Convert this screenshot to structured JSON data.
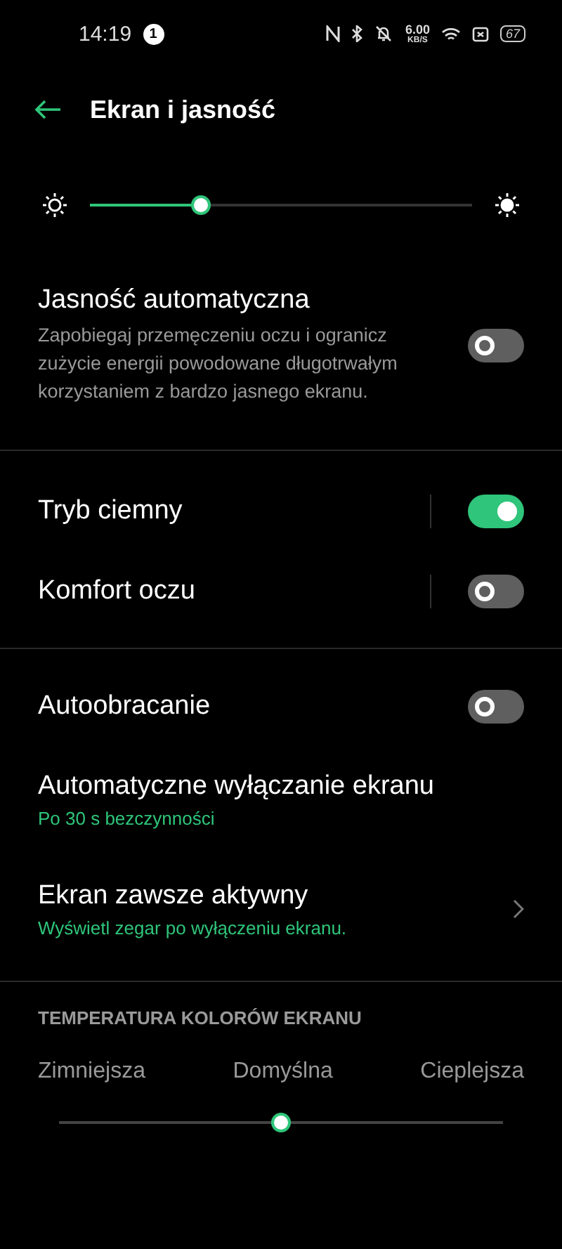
{
  "status_bar": {
    "time": "14:19",
    "notification_count": "1",
    "net_speed": "6.00",
    "net_unit": "KB/S",
    "battery": "67"
  },
  "header": {
    "title": "Ekran i jasność"
  },
  "brightness": {
    "level": 0.29
  },
  "sections": [
    {
      "items": [
        {
          "kind": "toggle",
          "title": "Jasność automatyczna",
          "description": "Zapobiegaj przemęczeniu oczu i ogranicz zużycie energii powodowane długotrwałym korzystaniem z bardzo jasnego ekranu.",
          "on": false
        }
      ]
    },
    {
      "items": [
        {
          "kind": "toggle_split",
          "title": "Tryb ciemny",
          "on": true
        },
        {
          "kind": "toggle_split",
          "title": "Komfort oczu",
          "on": false
        }
      ]
    },
    {
      "items": [
        {
          "kind": "toggle",
          "title": "Autoobracanie",
          "on": false
        },
        {
          "kind": "value",
          "title": "Automatyczne wyłączanie ekranu",
          "value": "Po 30 s bezczynności"
        },
        {
          "kind": "link",
          "title": "Ekran zawsze aktywny",
          "value": "Wyświetl zegar po wyłączeniu ekranu."
        }
      ]
    }
  ],
  "color_temperature": {
    "heading": "TEMPERATURA KOLORÓW EKRANU",
    "labels": [
      "Zimniejsza",
      "Domyślna",
      "Cieplejsza"
    ],
    "level": 0.5
  }
}
